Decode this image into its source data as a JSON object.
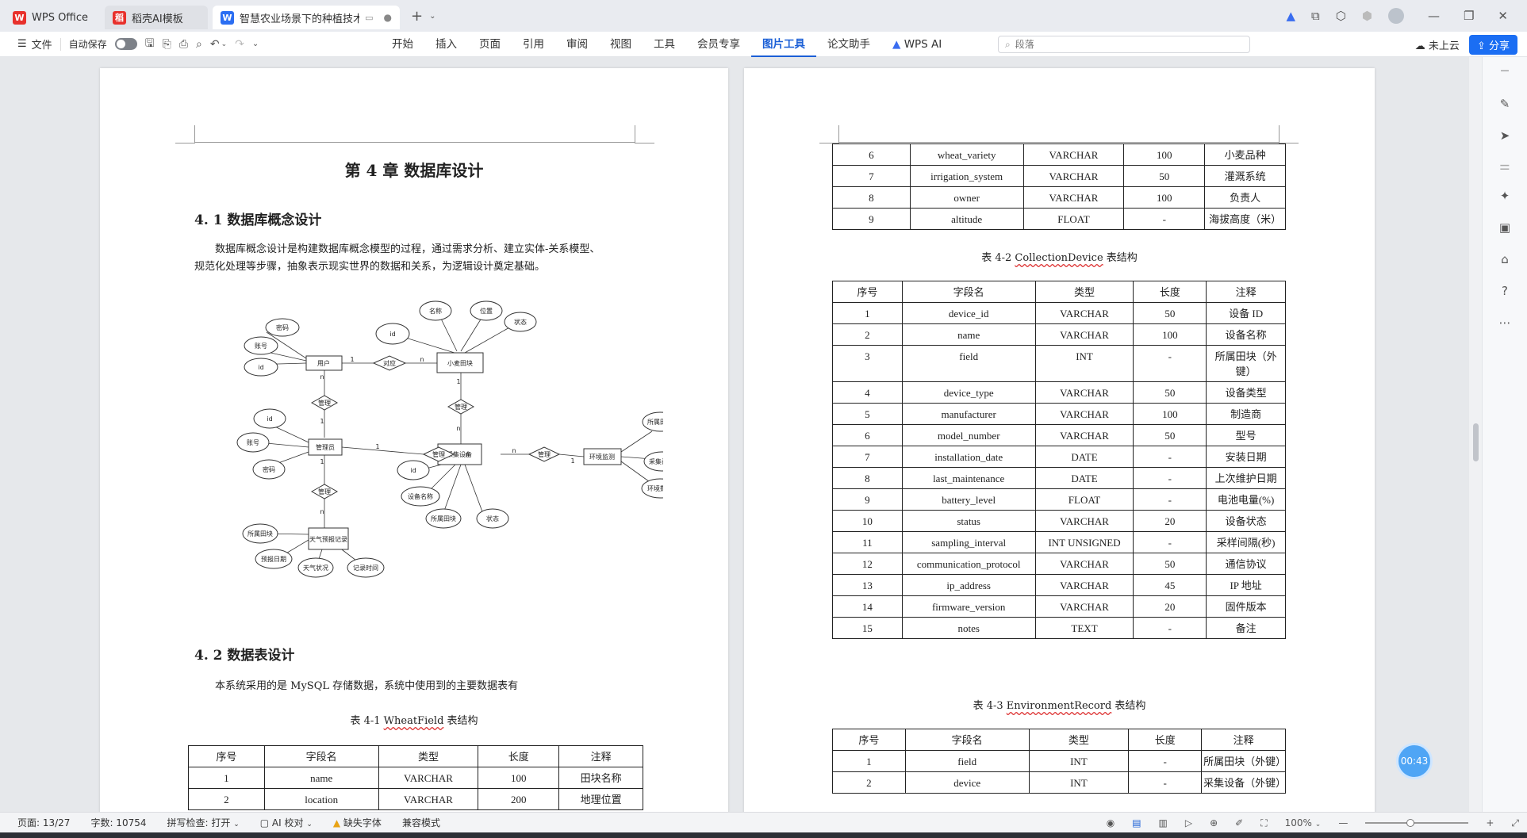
{
  "titlebar": {
    "tabs": [
      {
        "label": "WPS Office",
        "icon": "wps-logo-icon",
        "color": "#e8312c"
      },
      {
        "label": "稻壳AI模板",
        "icon": "daoke-logo-icon",
        "color": "#e8312c"
      },
      {
        "label": "智慧农业场景下的种植技术平",
        "icon": "word-doc-icon",
        "color": "#2b6ef2"
      }
    ]
  },
  "menubar": {
    "file_label": "文件",
    "autosave_label": "自动保存",
    "menus": [
      "开始",
      "插入",
      "页面",
      "引用",
      "审阅",
      "视图",
      "工具",
      "会员专享",
      "图片工具",
      "论文助手",
      "WPS AI"
    ],
    "active_menu": "图片工具",
    "search_placeholder": "段落",
    "cloud_label": "未上云",
    "share_label": "分享"
  },
  "left_page": {
    "chapter_title": "第 4 章  数据库设计",
    "section1_title": "4. 1 数据库概念设计",
    "section1_para1": "数据库概念设计是构建数据库概念模型的过程，通过需求分析、建立实体-关系模型、",
    "section1_para2": "规范化处理等步骤，抽象表示现实世界的数据和关系，为逻辑设计奠定基础。",
    "section2_title": "4. 2 数据表设计",
    "section2_para": "本系统采用的是 MySQL 存储数据，系统中使用到的主要数据表有",
    "table1_caption_prefix": "表 4-1 ",
    "table1_caption_name": "WheatField",
    "table1_caption_suffix": "  表结构",
    "table1_headers": [
      "序号",
      "字段名",
      "类型",
      "长度",
      "注释"
    ],
    "table1_rows": [
      [
        "1",
        "name",
        "VARCHAR",
        "100",
        "田块名称"
      ],
      [
        "2",
        "location",
        "VARCHAR",
        "200",
        "地理位置"
      ]
    ],
    "er": {
      "entities": [
        "用户",
        "小麦田块",
        "管理员",
        "采集设备",
        "环境监测",
        "天气预报记录"
      ],
      "relations": [
        "对应",
        "管理",
        "管理",
        "管理",
        "管理",
        "管理"
      ],
      "attributes": [
        "密码",
        "账号",
        "id",
        "id",
        "名称",
        "位置",
        "状态",
        "id",
        "账号",
        "密码",
        "id",
        "设备名称",
        "所属田块",
        "状态",
        "所属田块",
        "采集设备",
        "环境数据",
        "所属田块",
        "预报日期",
        "天气状况",
        "记录时间"
      ],
      "cardinalities": [
        "1",
        "n",
        "n",
        "1",
        "1",
        "n",
        "1",
        "n",
        "n",
        "1",
        "1",
        "n",
        "1",
        "n"
      ]
    }
  },
  "right_page": {
    "table1_cont_rows": [
      [
        "6",
        "wheat_variety",
        "VARCHAR",
        "100",
        "小麦品种"
      ],
      [
        "7",
        "irrigation_system",
        "VARCHAR",
        "50",
        "灌溉系统"
      ],
      [
        "8",
        "owner",
        "VARCHAR",
        "100",
        "负责人"
      ],
      [
        "9",
        "altitude",
        "FLOAT",
        "-",
        "海拔高度（米）"
      ]
    ],
    "table2_caption_prefix": "表 4-2 ",
    "table2_caption_name": "CollectionDevice",
    "table2_caption_suffix": "  表结构",
    "table2_headers": [
      "序号",
      "字段名",
      "类型",
      "长度",
      "注释"
    ],
    "table2_rows": [
      [
        "1",
        "device_id",
        "VARCHAR",
        "50",
        "设备 ID"
      ],
      [
        "2",
        "name",
        "VARCHAR",
        "100",
        "设备名称"
      ],
      [
        "3",
        "field",
        "INT",
        "-",
        "所属田块（外键）"
      ],
      [
        "4",
        "device_type",
        "VARCHAR",
        "50",
        "设备类型"
      ],
      [
        "5",
        "manufacturer",
        "VARCHAR",
        "100",
        "制造商"
      ],
      [
        "6",
        "model_number",
        "VARCHAR",
        "50",
        "型号"
      ],
      [
        "7",
        "installation_date",
        "DATE",
        "-",
        "安装日期"
      ],
      [
        "8",
        "last_maintenance",
        "DATE",
        "-",
        "上次维护日期"
      ],
      [
        "9",
        "battery_level",
        "FLOAT",
        "-",
        "电池电量(%)"
      ],
      [
        "10",
        "status",
        "VARCHAR",
        "20",
        "设备状态"
      ],
      [
        "11",
        "sampling_interval",
        "INT UNSIGNED",
        "-",
        "采样间隔(秒)"
      ],
      [
        "12",
        "communication_protocol",
        "VARCHAR",
        "50",
        "通信协议"
      ],
      [
        "13",
        "ip_address",
        "VARCHAR",
        "45",
        "IP 地址"
      ],
      [
        "14",
        "firmware_version",
        "VARCHAR",
        "20",
        "固件版本"
      ],
      [
        "15",
        "notes",
        "TEXT",
        "-",
        "备注"
      ]
    ],
    "table3_caption_prefix": "表 4-3 ",
    "table3_caption_name": "EnvironmentRecord",
    "table3_caption_suffix": "  表结构",
    "table3_headers": [
      "序号",
      "字段名",
      "类型",
      "长度",
      "注释"
    ],
    "table3_rows": [
      [
        "1",
        "field",
        "INT",
        "-",
        "所属田块（外键）"
      ],
      [
        "2",
        "device",
        "INT",
        "-",
        "采集设备（外键）"
      ]
    ]
  },
  "timer_label": "00:43",
  "statusbar": {
    "page": "页面: 13/27",
    "words": "字数: 10754",
    "spell": "拼写检查: 打开",
    "ai_check": "AI 校对",
    "missing_font": "缺失字体",
    "compat": "兼容模式",
    "zoom": "100%"
  }
}
